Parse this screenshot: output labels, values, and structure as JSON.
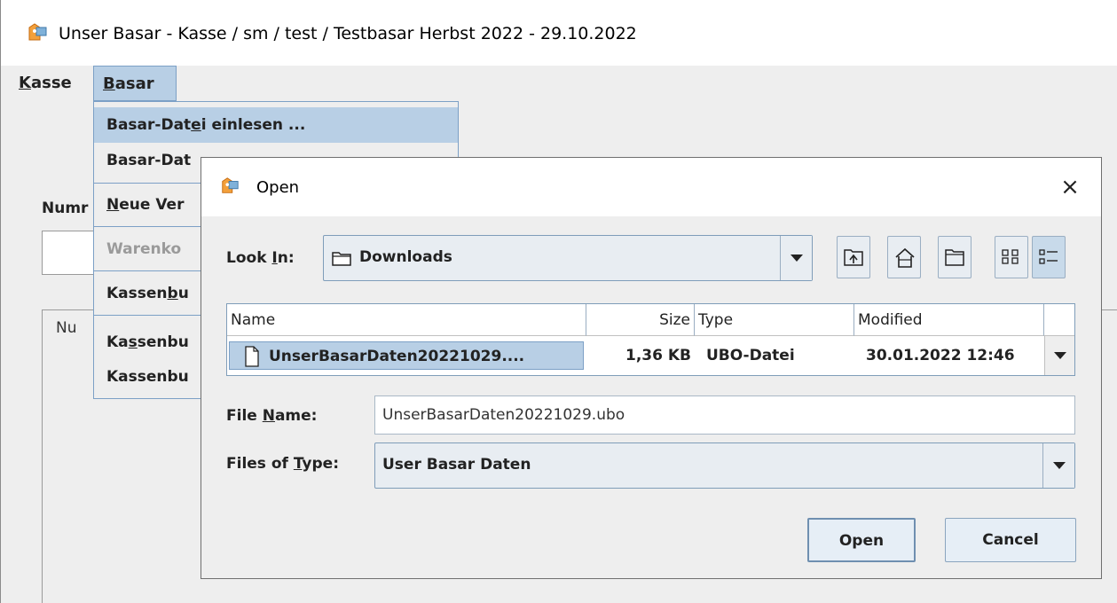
{
  "window": {
    "title": "Unser Basar - Kasse / sm / test / Testbasar Herbst 2022 - 29.10.2022"
  },
  "menubar": {
    "items": [
      {
        "pre": "",
        "mn": "K",
        "post": "asse"
      },
      {
        "pre": "",
        "mn": "B",
        "post": "asar"
      }
    ]
  },
  "dropdown": {
    "items": [
      {
        "pre": "Basar-Dat",
        "mn": "e",
        "post": "i einlesen ..."
      },
      {
        "pre": "Basar-Dat",
        "mn": "",
        "post": ""
      },
      {
        "pre": "",
        "mn": "N",
        "post": "eue Ver"
      },
      {
        "pre": "Warenko",
        "mn": "",
        "post": ""
      },
      {
        "pre": "Kassen",
        "mn": "b",
        "post": "u"
      },
      {
        "pre": "Ka",
        "mn": "s",
        "post": "senbu"
      },
      {
        "pre": "Kassenbu",
        "mn": "",
        "post": ""
      }
    ]
  },
  "background": {
    "numm_label": "Numr",
    "table_header": "Nu"
  },
  "dialog": {
    "title": "Open",
    "close": "×",
    "look_in": {
      "pre": "Look ",
      "mn": "I",
      "post": "n:"
    },
    "look_in_value": "Downloads",
    "columns": {
      "name": "Name",
      "size": "Size",
      "type": "Type",
      "modified": "Modified"
    },
    "files": [
      {
        "name": "UnserBasarDaten20221029....",
        "size": "1,36 KB",
        "type": "UBO-Datei",
        "modified": "30.01.2022 12:46"
      }
    ],
    "file_name_label": {
      "pre": "File ",
      "mn": "N",
      "post": "ame:"
    },
    "file_name_value": "UnserBasarDaten20221029.ubo",
    "files_of_type_label": {
      "pre": "Files of ",
      "mn": "T",
      "post": "ype:"
    },
    "files_of_type_value": "User Basar Daten",
    "open_button": "Open",
    "cancel_button": "Cancel"
  },
  "icons": {
    "app": "basar-app-icon",
    "folder": "folder-icon",
    "up": "up-one-level-icon",
    "home": "home-icon",
    "new_folder": "new-folder-icon",
    "list_view": "list-view-icon",
    "details_view": "details-view-icon",
    "file": "file-icon"
  },
  "colors": {
    "selection": "#b8cfe5",
    "selection_border": "#7ca0c6",
    "background": "#eeeeee"
  }
}
